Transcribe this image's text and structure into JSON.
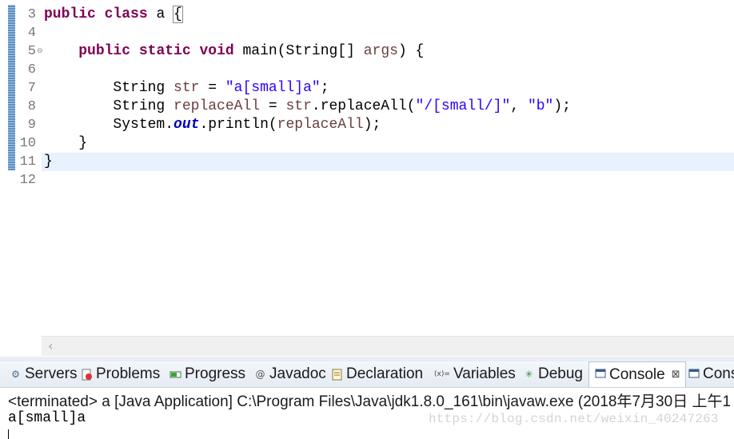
{
  "editor": {
    "line_numbers": [
      "3",
      "4",
      "5",
      "6",
      "7",
      "8",
      "9",
      "10",
      "11",
      "12"
    ],
    "fold_marker": "⊖",
    "lines": {
      "l3": {
        "kw1": "public",
        "kw2": "class",
        "name": " a ",
        "brace": "{"
      },
      "l5": {
        "kw1": "public",
        "kw2": "static",
        "kw3": "void",
        "rest": " main(String[] ",
        "arg": "args",
        "end": ") {"
      },
      "l7": {
        "type": "String ",
        "var": "str",
        "eq": " = ",
        "str": "\"a[small]a\"",
        "end": ";"
      },
      "l8": {
        "type": "String ",
        "var": "replaceAll",
        "eq": " = ",
        "ref": "str",
        "call": ".replaceAll(",
        "str1": "\"/[small/]\"",
        "comma": ", ",
        "str2": "\"b\"",
        "end": ");"
      },
      "l9": {
        "pre": "System.",
        "field": "out",
        "call": ".println(",
        "var": "replaceAll",
        "end": ");"
      },
      "l10": {
        "text": "}"
      },
      "l11": {
        "text": "}"
      }
    },
    "scroll_left_icon": "chevron-left"
  },
  "panel": {
    "tabs": [
      {
        "label": "Servers",
        "icon": "servers-icon"
      },
      {
        "label": "Problems",
        "icon": "problems-icon"
      },
      {
        "label": "Progress",
        "icon": "progress-icon"
      },
      {
        "label": "Javadoc",
        "icon": "javadoc-icon"
      },
      {
        "label": "Declaration",
        "icon": "declaration-icon"
      },
      {
        "label": "Variables",
        "icon": "variables-icon",
        "icon_text": "(x)="
      },
      {
        "label": "Debug",
        "icon": "debug-icon"
      },
      {
        "label": "Console",
        "icon": "console-icon",
        "active": true,
        "close": "⊠"
      },
      {
        "label": "Cons",
        "icon": "console-icon"
      }
    ],
    "console": {
      "status": "<terminated> a [Java Application] C:\\Program Files\\Java\\jdk1.8.0_161\\bin\\javaw.exe (2018年7月30日 上午1",
      "output": "a[small]a",
      "watermark": "https://blog.csdn.net/weixin_40247263"
    }
  },
  "colors": {
    "keyword": "#7f0055",
    "string": "#2a00ff",
    "local_var": "#6a3e3e",
    "static_field": "#0000c0",
    "current_line": "#e8f2fe"
  }
}
